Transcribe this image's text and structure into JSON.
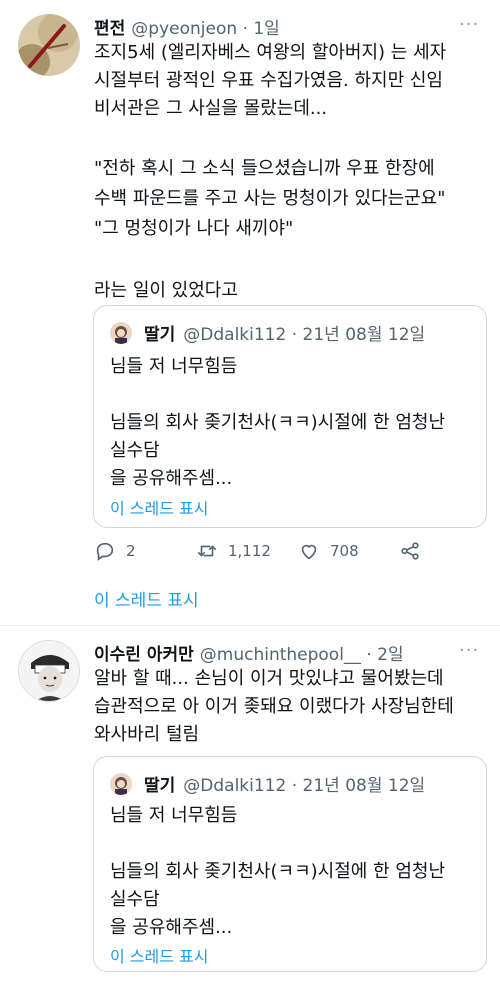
{
  "tweets": [
    {
      "name": "편전",
      "handle": "@pyeonjeon · 1일",
      "avatar_icon": "stick-photo-avatar",
      "body": [
        "조지5세 (엘리자베스 여왕의 할아버지) 는 세자",
        "시절부터 광적인 우표 수집가였음. 하지만 신임",
        "비서관은 그 사실을 몰랐는데...",
        "",
        "\"전하 혹시 그 소식 들으셨습니까 우표 한장에",
        "수백 파운드를 주고 사는 멍청이가 있다는군요\"",
        "\"그 멍청이가 나다 새끼야\"",
        "",
        "라는 일이 있었다고"
      ],
      "quote": {
        "name": "딸기",
        "handle": "@Ddalki112 · 21년 08월 12일",
        "lines": [
          "님들 저 너무힘듬",
          "",
          "님들의 회사 좆기천사(ㅋㅋ)시절에 한 엄청난",
          "실수담",
          "을 공유해주셈..."
        ],
        "thread_link": "이 스레드 표시"
      },
      "actions": {
        "reply_count": "2",
        "retweet_count": "1,112",
        "like_count": "708"
      },
      "thread_link": "이 스레드 표시"
    },
    {
      "name": "이수린 아커만",
      "handle": "@muchinthepool__ · 2일",
      "avatar_icon": "person-sketch-avatar",
      "body": [
        "알바 할 때... 손님이 이거 맛있냐고 물어봤는데",
        "습관적으로 아 이거 좆돼요 이랬다가 사장님한테",
        "와사바리 털림"
      ],
      "quote": {
        "name": "딸기",
        "handle": "@Ddalki112 · 21년 08월 12일",
        "lines": [
          "님들 저 너무힘듬",
          "",
          "님들의 회사 좆기천사(ㅋㅋ)시절에 한 엄청난",
          "실수담",
          "을 공유해주셈..."
        ],
        "thread_link": "이 스레드 표시"
      }
    }
  ],
  "colors": {
    "accent": "#1d9bf0",
    "muted": "#536471",
    "border": "#cfd9de"
  },
  "icons": {
    "more": "more-icon",
    "reply": "reply-icon",
    "retweet": "retweet-icon",
    "like": "heart-icon",
    "share": "share-icon"
  }
}
